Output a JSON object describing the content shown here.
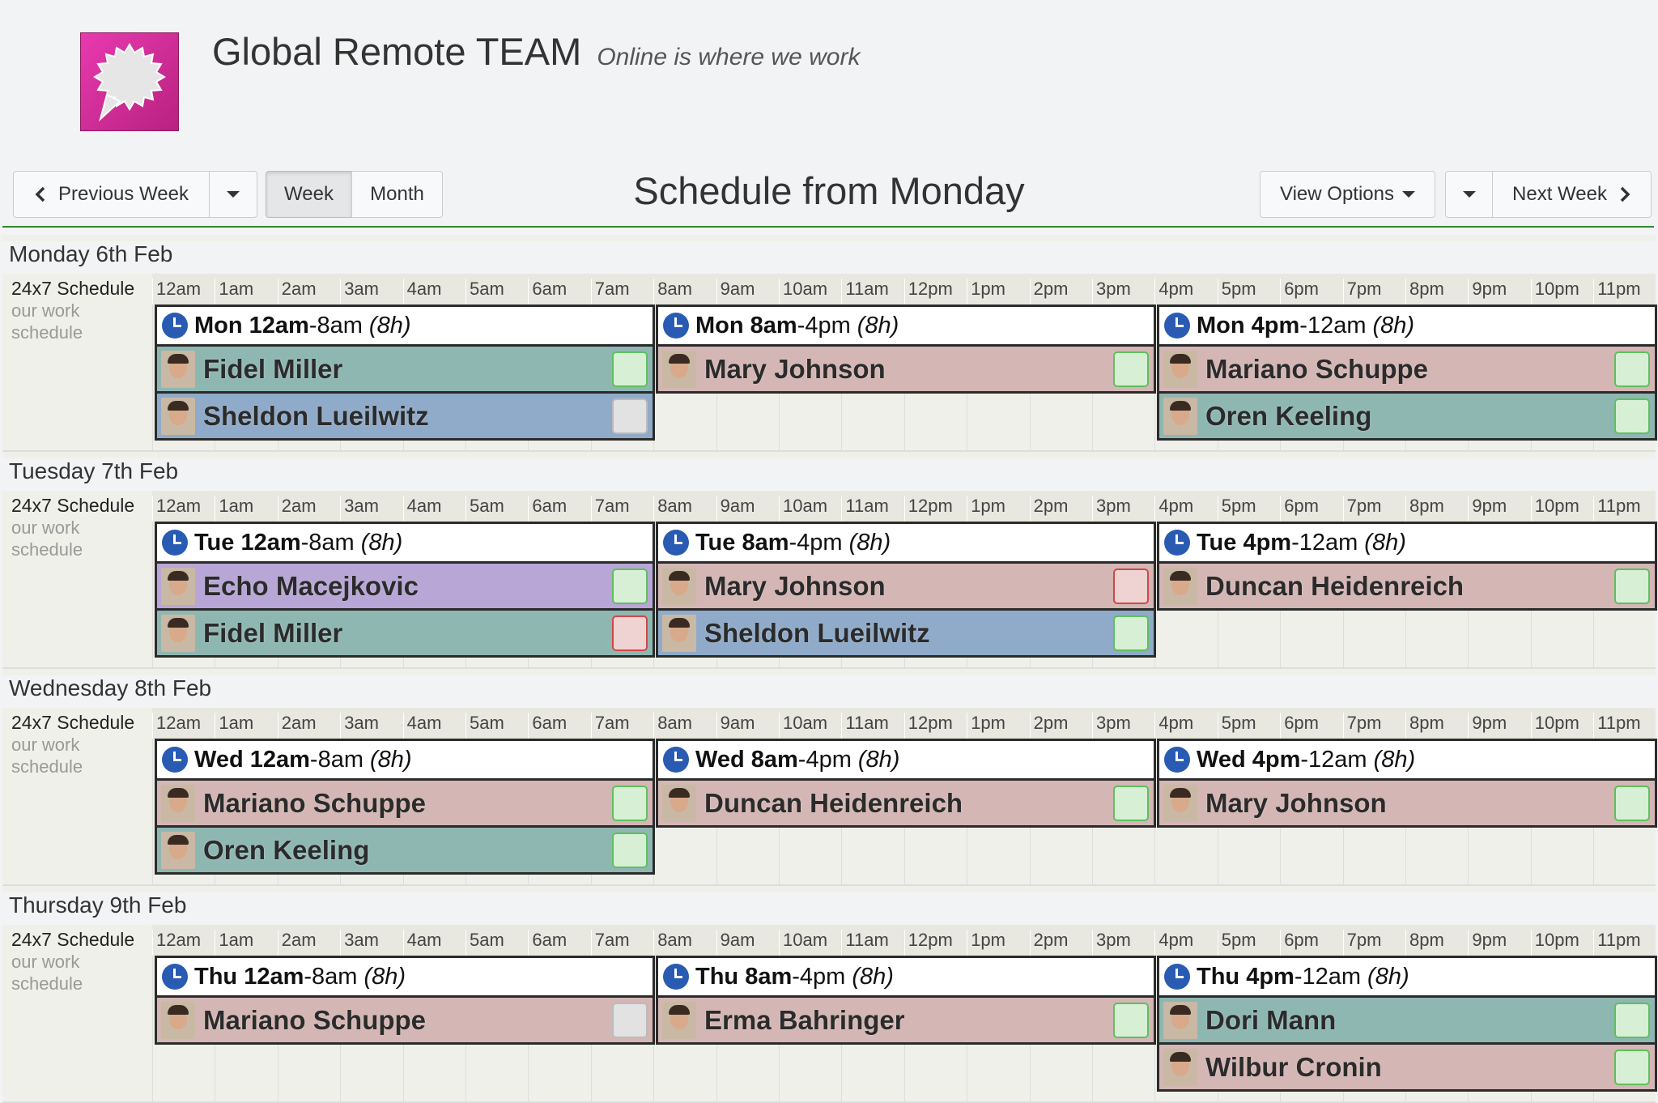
{
  "header": {
    "title": "Global Remote TEAM",
    "tagline": "Online is where we work",
    "logo_icon": "speech-bubble-icon"
  },
  "toolbar": {
    "prev_week": "Previous Week",
    "week": "Week",
    "month": "Month",
    "heading": "Schedule from Monday",
    "view_options": "View Options",
    "next_week": "Next Week"
  },
  "hours": [
    "12am",
    "1am",
    "2am",
    "3am",
    "4am",
    "5am",
    "6am",
    "7am",
    "8am",
    "9am",
    "10am",
    "11am",
    "12pm",
    "1pm",
    "2pm",
    "3pm",
    "4pm",
    "5pm",
    "6pm",
    "7pm",
    "8pm",
    "9pm",
    "10pm",
    "11pm"
  ],
  "schedule_name": "24x7 Schedule",
  "schedule_desc_1": "our work",
  "schedule_desc_2": "schedule",
  "days": [
    {
      "title": "Monday 6th Feb",
      "shifts": [
        {
          "start": "Mon 12am",
          "end": "-8am",
          "dur": "(8h)",
          "people": [
            {
              "name": "Fidel Miller",
              "color": "#8fb7b2",
              "status": "green"
            },
            {
              "name": "Sheldon Lueilwitz",
              "color": "#8fabc9",
              "status": "grey"
            }
          ]
        },
        {
          "start": "Mon 8am",
          "end": "-4pm",
          "dur": "(8h)",
          "people": [
            {
              "name": "Mary Johnson",
              "color": "#d4b6b4",
              "status": "green"
            }
          ]
        },
        {
          "start": "Mon 4pm",
          "end": "-12am",
          "dur": "(8h)",
          "people": [
            {
              "name": "Mariano Schuppe",
              "color": "#d4b6b4",
              "status": "green"
            },
            {
              "name": "Oren Keeling",
              "color": "#8fb7b2",
              "status": "green"
            }
          ]
        }
      ]
    },
    {
      "title": "Tuesday 7th Feb",
      "shifts": [
        {
          "start": "Tue 12am",
          "end": "-8am",
          "dur": "(8h)",
          "people": [
            {
              "name": "Echo Macejkovic",
              "color": "#b7a6d6",
              "status": "green"
            },
            {
              "name": "Fidel Miller",
              "color": "#8fb7b2",
              "status": "red"
            }
          ]
        },
        {
          "start": "Tue 8am",
          "end": "-4pm",
          "dur": "(8h)",
          "people": [
            {
              "name": "Mary Johnson",
              "color": "#d4b6b4",
              "status": "red"
            },
            {
              "name": "Sheldon Lueilwitz",
              "color": "#8fabc9",
              "status": "green"
            }
          ]
        },
        {
          "start": "Tue 4pm",
          "end": "-12am",
          "dur": "(8h)",
          "people": [
            {
              "name": "Duncan Heidenreich",
              "color": "#d4b6b4",
              "status": "green"
            }
          ]
        }
      ]
    },
    {
      "title": "Wednesday 8th Feb",
      "shifts": [
        {
          "start": "Wed 12am",
          "end": "-8am",
          "dur": "(8h)",
          "people": [
            {
              "name": "Mariano Schuppe",
              "color": "#d4b6b4",
              "status": "green"
            },
            {
              "name": "Oren Keeling",
              "color": "#8fb7b2",
              "status": "green"
            }
          ]
        },
        {
          "start": "Wed 8am",
          "end": "-4pm",
          "dur": "(8h)",
          "people": [
            {
              "name": "Duncan Heidenreich",
              "color": "#d4b6b4",
              "status": "green"
            }
          ]
        },
        {
          "start": "Wed 4pm",
          "end": "-12am",
          "dur": "(8h)",
          "people": [
            {
              "name": "Mary Johnson",
              "color": "#d4b6b4",
              "status": "green"
            }
          ]
        }
      ]
    },
    {
      "title": "Thursday 9th Feb",
      "shifts": [
        {
          "start": "Thu 12am",
          "end": "-8am",
          "dur": "(8h)",
          "people": [
            {
              "name": "Mariano Schuppe",
              "color": "#d4b6b4",
              "status": "grey"
            }
          ]
        },
        {
          "start": "Thu 8am",
          "end": "-4pm",
          "dur": "(8h)",
          "people": [
            {
              "name": "Erma Bahringer",
              "color": "#d4b6b4",
              "status": "green"
            }
          ]
        },
        {
          "start": "Thu 4pm",
          "end": "-12am",
          "dur": "(8h)",
          "people": [
            {
              "name": "Dori Mann",
              "color": "#8fb7b2",
              "status": "green"
            },
            {
              "name": "Wilbur Cronin",
              "color": "#d4b6b4",
              "status": "green"
            }
          ]
        }
      ]
    }
  ]
}
